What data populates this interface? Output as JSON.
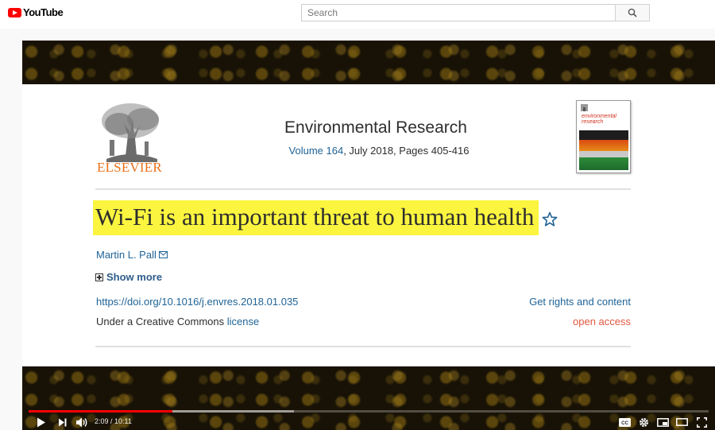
{
  "app": {
    "brand": "YouTube"
  },
  "search": {
    "placeholder": "Search",
    "value": ""
  },
  "article": {
    "publisher": "ELSEVIER",
    "journal": "Environmental Research",
    "volume_label": "Volume 164",
    "meta_rest": ", July 2018, Pages 405-416",
    "cover_title": "environmental research",
    "title": "Wi-Fi is an important threat to human health",
    "author": "Martin L. Pall",
    "show_more": "Show more",
    "doi": "https://doi.org/10.1016/j.envres.2018.01.035",
    "rights": "Get rights and content",
    "license_prefix": "Under a Creative Commons ",
    "license_link": "license",
    "access": "open access"
  },
  "player": {
    "current_time": "2:09",
    "duration": "10:11",
    "time_display": "2:09 / 10:11",
    "played_fraction": 0.211,
    "loaded_fraction": 0.39,
    "icons": [
      "play-icon",
      "next-icon",
      "volume-icon",
      "captions-icon",
      "settings-icon",
      "miniplayer-icon",
      "theater-icon",
      "fullscreen-icon"
    ]
  },
  "colors": {
    "brand_red": "#ff0000",
    "highlight": "#fbf53f",
    "link": "#1f6396",
    "elsevier_orange": "#e9711c",
    "open_access": "#e0583f"
  }
}
